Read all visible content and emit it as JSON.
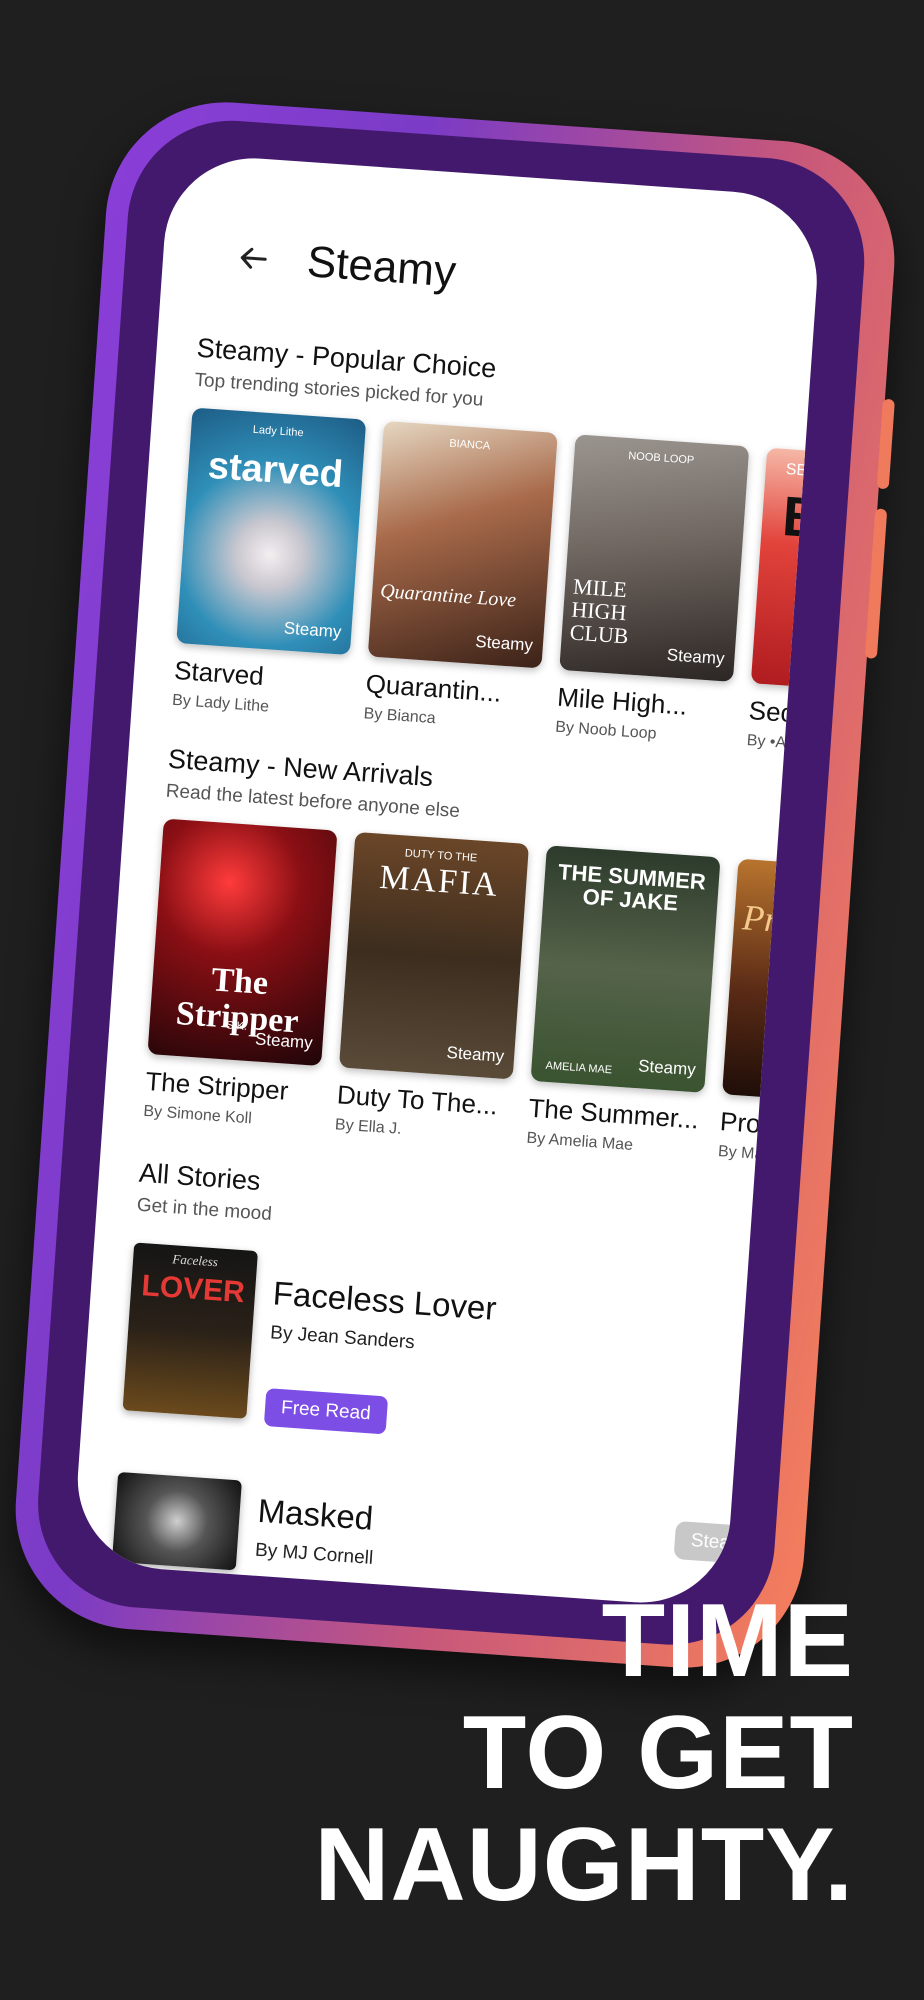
{
  "header": {
    "title": "Steamy"
  },
  "popular": {
    "title": "Steamy - Popular Choice",
    "subtitle": "Top trending stories picked for you",
    "books": [
      {
        "title": "Starved",
        "author": "By Lady Lithe",
        "cover_text": "starved",
        "cover_small": "Lady Lithe",
        "brand": "Steamy"
      },
      {
        "title": "Quarantin...",
        "author": "By Bianca",
        "cover_text": "Quarantine Love",
        "cover_small": "BIANCA",
        "brand": "Steamy"
      },
      {
        "title": "Mile High...",
        "author": "By  Noob Loop",
        "cover_text": "MILE HIGH CLUB",
        "cover_small": "NOOB LOOP",
        "brand": "Steamy"
      },
      {
        "title": "Seco",
        "author": "By •An",
        "cover_text": "BL",
        "cover_small": "SECO",
        "brand": ""
      }
    ]
  },
  "new_arrivals": {
    "title": "Steamy - New Arrivals",
    "subtitle": "Read the latest before anyone else",
    "books": [
      {
        "title": "The Stripper",
        "author": "By Simone Koll",
        "cover_text": "The Stripper",
        "cover_small": "S.K.",
        "brand": "Steamy"
      },
      {
        "title": "Duty To The...",
        "author": "By Ella J.",
        "cover_text": "MAFIA",
        "cover_small": "DUTY TO THE",
        "brand": "Steamy"
      },
      {
        "title": "The Summer...",
        "author": "By Amelia Mae",
        "cover_text": "THE SUMMER OF JAKE",
        "cover_small": "AMELIA MAE",
        "brand": "Steamy"
      },
      {
        "title": "Promi",
        "author": "By Mara",
        "cover_text": "Prom D",
        "cover_small": "",
        "brand": ""
      }
    ]
  },
  "all_stories": {
    "title": "All Stories",
    "subtitle": "Get in the mood",
    "items": [
      {
        "title": "Faceless Lover",
        "author": "By Jean Sanders",
        "button": "Free Read",
        "cover_small": "Faceless",
        "cover_text": "LOVER"
      },
      {
        "title": "Masked",
        "author": "By MJ Cornell"
      }
    ],
    "brand_tag": "Steamy"
  },
  "tagline": {
    "line1": "TIME",
    "line2": "TO GET",
    "line3": "NAUGHTY."
  },
  "colors": {
    "frame_purple": "#8a3fd8",
    "frame_coral": "#f57f5b",
    "button_purple": "#7c4ee6",
    "background": "#1f1f1f"
  }
}
